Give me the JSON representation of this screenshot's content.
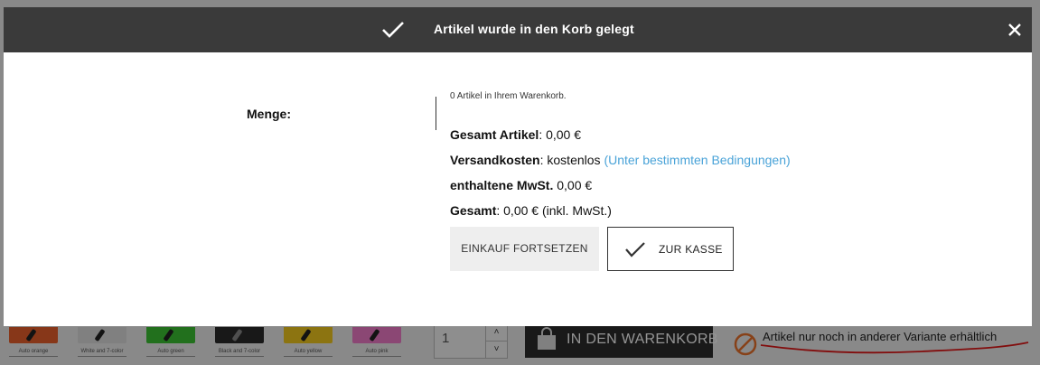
{
  "background_page": {
    "swatches": [
      {
        "caption": "Auto orange",
        "color": "#e8602c"
      },
      {
        "caption": "White and 7-color",
        "color": "#dcdcdc"
      },
      {
        "caption": "Auto green",
        "color": "#3cc232"
      },
      {
        "caption": "Black and 7-color",
        "color": "#2a2a2a"
      },
      {
        "caption": "Auto yellow",
        "color": "#f2c81e"
      },
      {
        "caption": "Auto pink",
        "color": "#f07ac8"
      }
    ],
    "quantity": {
      "value": "1",
      "up_glyph": "˄",
      "down_glyph": "˅"
    },
    "add_to_cart_label": "IN DEN WARENKORB",
    "variant_notice": "Artikel nur noch in anderer Variante erhältlich",
    "notice_icon_color": "#e8702a",
    "scribble_color": "#e01818"
  },
  "modal": {
    "title": "Artikel wurde in den Korb gelegt",
    "close_glyph": "✕",
    "quantity_label": "Menge:",
    "cart_count_text": "0 Artikel in Ihrem Warenkorb.",
    "summary": {
      "total_items_label": "Gesamt Artikel",
      "total_items_value": ": 0,00 €",
      "shipping_label": "Versandkosten",
      "shipping_value": ": kostenlos ",
      "shipping_link": "(Unter bestimmten Bedingungen)",
      "tax_label": "enthaltene MwSt.",
      "tax_value": " 0,00 €",
      "total_label": "Gesamt",
      "total_value": ": 0,00 € (inkl. MwSt.)"
    },
    "continue_button": "EINKAUF FORTSETZEN",
    "checkout_button": "ZUR KASSE",
    "link_color": "#4aa3d8"
  }
}
